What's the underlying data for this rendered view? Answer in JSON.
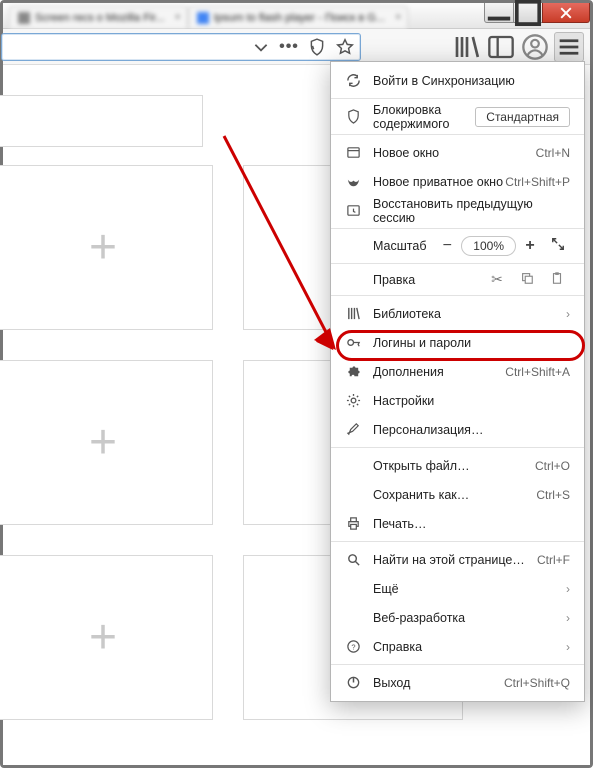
{
  "tabs": [
    {
      "label": "Screen recs o Mozilla Fir..."
    },
    {
      "label": "Ipsum to flash player - Поиск в G..."
    }
  ],
  "menu": {
    "sync": "Войти в Синхронизацию",
    "content_blocking": "Блокировка содержимого",
    "content_blocking_mode": "Стандартная",
    "new_window": "Новое окно",
    "new_window_sc": "Ctrl+N",
    "new_private": "Новое приватное окно",
    "new_private_sc": "Ctrl+Shift+P",
    "restore_session": "Восстановить предыдущую сессию",
    "zoom_label": "Масштаб",
    "zoom_pct": "100%",
    "edit_label": "Правка",
    "library": "Библиотека",
    "logins": "Логины и пароли",
    "addons": "Дополнения",
    "addons_sc": "Ctrl+Shift+A",
    "settings": "Настройки",
    "customize": "Персонализация…",
    "open_file": "Открыть файл…",
    "open_file_sc": "Ctrl+O",
    "save_as": "Сохранить как…",
    "save_as_sc": "Ctrl+S",
    "print": "Печать…",
    "find": "Найти на этой странице…",
    "find_sc": "Ctrl+F",
    "more": "Ещё",
    "webdev": "Веб-разработка",
    "help": "Справка",
    "exit": "Выход",
    "exit_sc": "Ctrl+Shift+Q"
  }
}
